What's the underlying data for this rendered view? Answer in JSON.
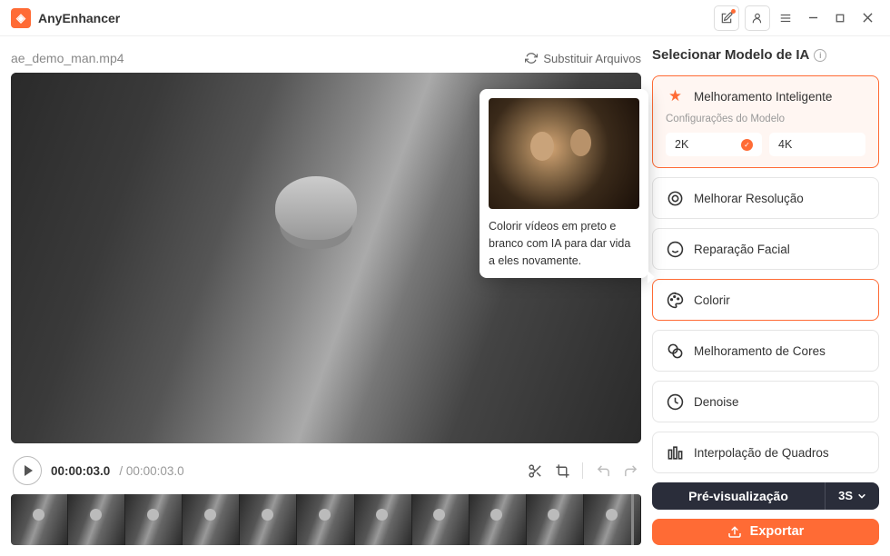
{
  "app": {
    "name": "AnyEnhancer"
  },
  "file": {
    "name": "ae_demo_man.mp4",
    "replace_label": "Substituir Arquivos"
  },
  "player": {
    "current": "00:00:03.0",
    "duration": "00:00:03.0"
  },
  "tooltip": {
    "text": "Colorir vídeos em preto e branco com IA para dar vida a eles novamente."
  },
  "panel": {
    "title": "Selecionar Modelo de IA"
  },
  "models": {
    "smart": {
      "label": "Melhoramento Inteligente",
      "config_label": "Configurações do Modelo",
      "opts": [
        "2K",
        "4K"
      ],
      "selected": "2K"
    },
    "upscale": {
      "label": "Melhorar Resolução"
    },
    "face": {
      "label": "Reparação Facial"
    },
    "colorize": {
      "label": "Colorir"
    },
    "color_enhance": {
      "label": "Melhoramento de Cores"
    },
    "denoise": {
      "label": "Denoise"
    },
    "interp": {
      "label": "Interpolação de Quadros"
    }
  },
  "preview_btn": {
    "label": "Pré-visualização",
    "duration": "3S"
  },
  "export_btn": {
    "label": "Exportar"
  }
}
